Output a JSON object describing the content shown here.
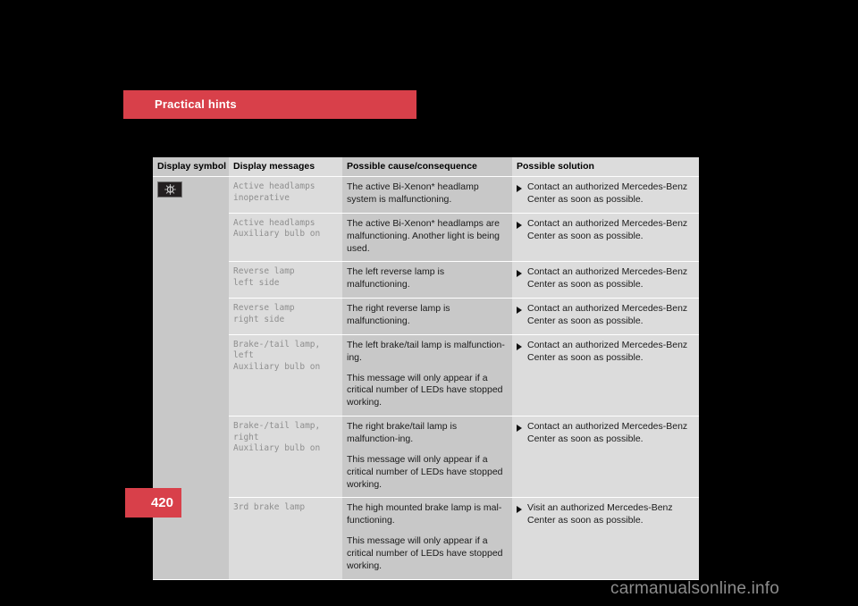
{
  "page": {
    "section_title": "Practical hints",
    "page_number": "420",
    "watermark": "carmanualsonline.info",
    "accent_color": "#d8404a"
  },
  "table": {
    "headers": [
      "Display symbol",
      "Display messages",
      "Possible cause/consequence",
      "Possible solution"
    ],
    "symbol_icon": "headlamp-indicator-icon",
    "rows": [
      {
        "message": "Active headlamps\ninoperative",
        "cause": [
          "The active Bi-Xenon* headlamp system is malfunctioning."
        ],
        "solution": "Contact an authorized Mercedes-Benz Center as soon as possible."
      },
      {
        "message": "Active headlamps\nAuxiliary bulb on",
        "cause": [
          "The active Bi-Xenon* headlamps are malfunctioning. Another light is being used."
        ],
        "solution": "Contact an authorized Mercedes-Benz Center as soon as possible."
      },
      {
        "message": "Reverse lamp\nleft side",
        "cause": [
          "The left reverse lamp is malfunctioning."
        ],
        "solution": "Contact an authorized Mercedes-Benz Center as soon as possible."
      },
      {
        "message": "Reverse lamp\nright side",
        "cause": [
          "The right reverse lamp is malfunctioning."
        ],
        "solution": "Contact an authorized Mercedes-Benz Center as soon as possible."
      },
      {
        "message": "Brake-/tail lamp, left\nAuxiliary bulb on",
        "cause": [
          "The left brake/tail lamp is malfunction-ing.",
          "This message will only appear if a critical number of LEDs have stopped working."
        ],
        "solution": "Contact an authorized Mercedes-Benz Center as soon as possible."
      },
      {
        "message": "Brake-/tail lamp, right\nAuxiliary bulb on",
        "cause": [
          "The right brake/tail lamp is malfunction-ing.",
          "This message will only appear if a critical number of LEDs have stopped working."
        ],
        "solution": "Contact an authorized Mercedes-Benz Center as soon as possible."
      },
      {
        "message": "3rd brake lamp",
        "cause": [
          "The high mounted brake lamp is mal-functioning.",
          "This message will only appear if a critical number of LEDs have stopped working."
        ],
        "solution": "Visit an authorized Mercedes-Benz Center as soon as possible."
      }
    ]
  }
}
